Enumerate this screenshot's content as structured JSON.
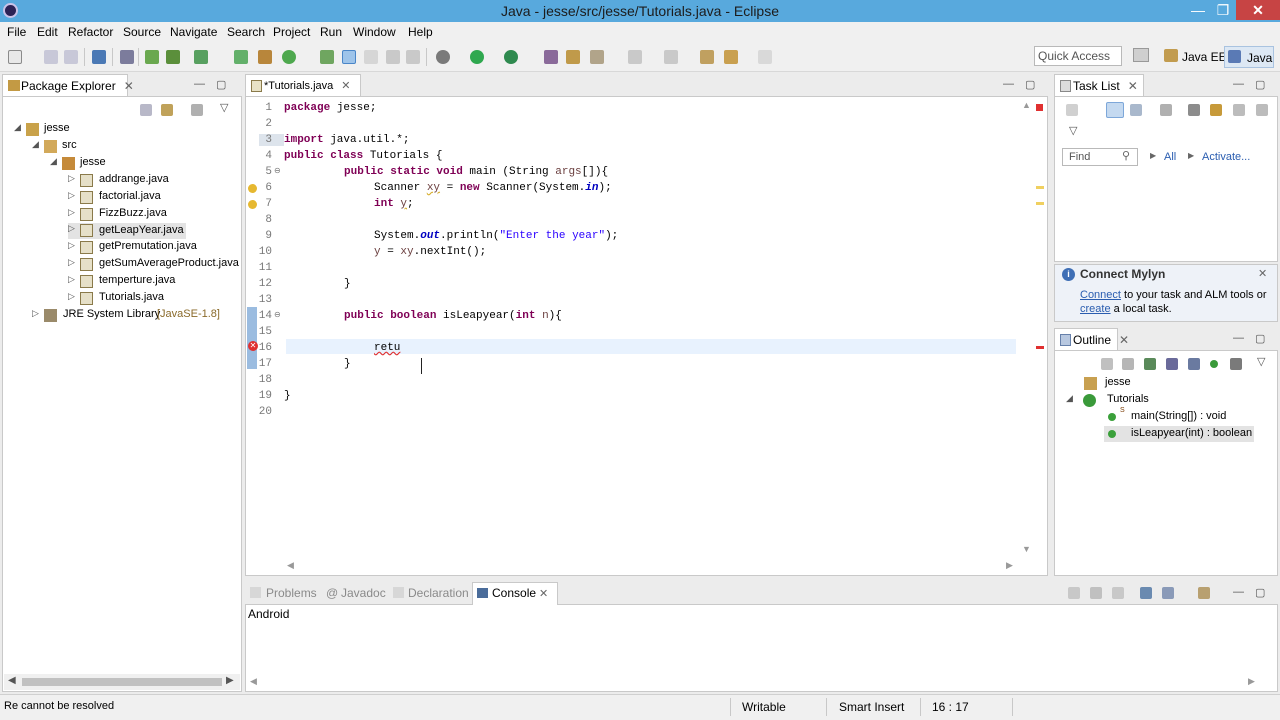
{
  "window": {
    "title": "Java - jesse/src/jesse/Tutorials.java - Eclipse",
    "minimize": "—",
    "restore": "❐",
    "close": "✕"
  },
  "menu": [
    "File",
    "Edit",
    "Refactor",
    "Source",
    "Navigate",
    "Search",
    "Project",
    "Run",
    "Window",
    "Help"
  ],
  "toolbar": {
    "quick_access": "Quick Access",
    "perspective_javaee": "Java EE",
    "perspective_java": "Java"
  },
  "package_explorer": {
    "tab_label": "Package Explorer",
    "project": "jesse",
    "src": "src",
    "package": "jesse",
    "files": [
      "addrange.java",
      "factorial.java",
      "FizzBuzz.java",
      "getLeapYear.java",
      "getPremutation.java",
      "getSumAverageProduct.java",
      "temperture.java",
      "Tutorials.java"
    ],
    "library": "JRE System Library",
    "library_version": "[JavaSE-1.8]"
  },
  "editor": {
    "tab_label": "*Tutorials.java",
    "line_numbers": [
      "1",
      "2",
      "3",
      "4",
      "5",
      "6",
      "7",
      "8",
      "9",
      "10",
      "11",
      "12",
      "13",
      "14",
      "15",
      "16",
      "17",
      "18",
      "19",
      "20"
    ],
    "lines": {
      "l1a": "package",
      "l1b": " jesse;",
      "l3a": "import",
      "l3b": " java.util.*;",
      "l4a": "public class",
      "l4b": " Tutorials {",
      "l5a": "public static void",
      "l5b": " main (String ",
      "l5c": "args",
      "l5d": "[]){",
      "l6a": "Scanner ",
      "l6b": "xy",
      "l6c": " = ",
      "l6d": "new",
      "l6e": " Scanner(System.",
      "l6f": "in",
      "l6g": ");",
      "l7a": "int",
      "l7b": " ",
      "l7c": "y",
      "l7d": ";",
      "l9a": "System.",
      "l9b": "out",
      "l9c": ".println(",
      "l9d": "\"Enter the year\"",
      "l9e": ");",
      "l10a": "y",
      "l10b": " = ",
      "l10c": "xy",
      "l10d": ".nextInt();",
      "l12": "}",
      "l14a": "public boolean",
      "l14b": " isLeapyear(",
      "l14c": "int",
      "l14d": " ",
      "l14e": "n",
      "l14f": "){",
      "l16": "retu",
      "l17": "}",
      "l19": "}"
    }
  },
  "task_list": {
    "tab_label": "Task List",
    "find_placeholder": "Find",
    "all": "All",
    "activate": "Activate..."
  },
  "mylyn": {
    "title": "Connect Mylyn",
    "link_connect": "Connect",
    "text1": " to your task and ALM tools or",
    "link_create": "create",
    "text2": " a local task."
  },
  "outline": {
    "tab_label": "Outline",
    "package": "jesse",
    "class": "Tutorials",
    "methods": [
      "main(String[]) : void",
      "isLeapyear(int) : boolean"
    ]
  },
  "bottom_panel": {
    "tabs": [
      "Problems",
      "Javadoc",
      "Declaration",
      "Console"
    ],
    "active": "Console",
    "console_text": "Android"
  },
  "statusbar": {
    "message": "Re cannot be resolved",
    "writable": "Writable",
    "insert_mode": "Smart Insert",
    "position": "16 : 17"
  },
  "colors": {
    "titlebar": "#58a9dd",
    "keyword": "#7f0055",
    "string": "#2a00ff",
    "field": "#0000c0",
    "error": "#e03030"
  }
}
